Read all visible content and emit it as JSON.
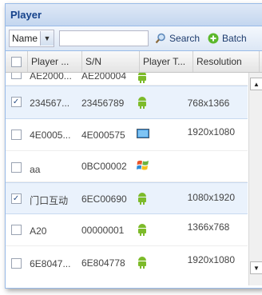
{
  "panel": {
    "title": "Player"
  },
  "toolbar": {
    "filter_field": "Name",
    "search_value": "",
    "search_label": "Search",
    "batch_label": "Batch"
  },
  "grid": {
    "columns": [
      "Player ...",
      "S/N",
      "Player T...",
      "Resolution"
    ],
    "rows": [
      {
        "name": "AE2000...",
        "sn": "AE200004",
        "type_icon": "android-icon",
        "resolution": "",
        "checked": false,
        "selected": false
      },
      {
        "name": "234567...",
        "sn": "23456789",
        "type_icon": "android-icon",
        "resolution": "768x1366",
        "checked": true,
        "selected": true
      },
      {
        "name": "4E0005...",
        "sn": "4E000575",
        "type_icon": "monitor-icon",
        "resolution": "1920x1080",
        "checked": false,
        "selected": false
      },
      {
        "name": "aa",
        "sn": "0BC00002",
        "type_icon": "windows-icon",
        "resolution": "",
        "checked": false,
        "selected": false
      },
      {
        "name": "门口互动",
        "sn": "6EC00690",
        "type_icon": "android-icon",
        "resolution": "1080x1920",
        "checked": true,
        "selected": true
      },
      {
        "name": "A20",
        "sn": "00000001",
        "type_icon": "android-icon",
        "resolution": "1366x768",
        "checked": false,
        "selected": false
      },
      {
        "name": "6E8047...",
        "sn": "6E804778",
        "type_icon": "android-icon",
        "resolution": "1920x1080",
        "checked": false,
        "selected": false
      }
    ]
  },
  "colors": {
    "header_text": "#15428b",
    "android": "#7dbb2a",
    "selected_row": "#eaf2fc"
  }
}
